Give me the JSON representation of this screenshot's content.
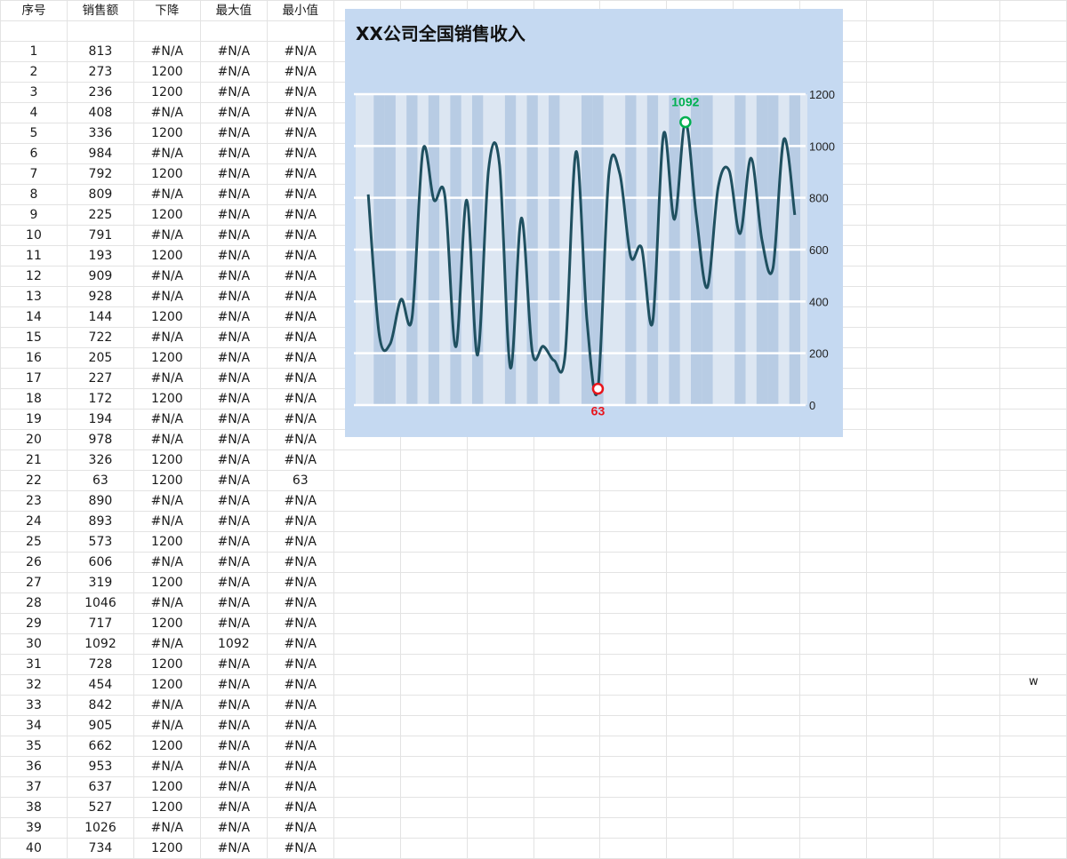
{
  "table": {
    "headers": [
      "序号",
      "销售额",
      "下降",
      "最大值",
      "最小值"
    ],
    "rows": [
      [
        "1",
        "813",
        "#N/A",
        "#N/A",
        "#N/A"
      ],
      [
        "2",
        "273",
        "1200",
        "#N/A",
        "#N/A"
      ],
      [
        "3",
        "236",
        "1200",
        "#N/A",
        "#N/A"
      ],
      [
        "4",
        "408",
        "#N/A",
        "#N/A",
        "#N/A"
      ],
      [
        "5",
        "336",
        "1200",
        "#N/A",
        "#N/A"
      ],
      [
        "6",
        "984",
        "#N/A",
        "#N/A",
        "#N/A"
      ],
      [
        "7",
        "792",
        "1200",
        "#N/A",
        "#N/A"
      ],
      [
        "8",
        "809",
        "#N/A",
        "#N/A",
        "#N/A"
      ],
      [
        "9",
        "225",
        "1200",
        "#N/A",
        "#N/A"
      ],
      [
        "10",
        "791",
        "#N/A",
        "#N/A",
        "#N/A"
      ],
      [
        "11",
        "193",
        "1200",
        "#N/A",
        "#N/A"
      ],
      [
        "12",
        "909",
        "#N/A",
        "#N/A",
        "#N/A"
      ],
      [
        "13",
        "928",
        "#N/A",
        "#N/A",
        "#N/A"
      ],
      [
        "14",
        "144",
        "1200",
        "#N/A",
        "#N/A"
      ],
      [
        "15",
        "722",
        "#N/A",
        "#N/A",
        "#N/A"
      ],
      [
        "16",
        "205",
        "1200",
        "#N/A",
        "#N/A"
      ],
      [
        "17",
        "227",
        "#N/A",
        "#N/A",
        "#N/A"
      ],
      [
        "18",
        "172",
        "1200",
        "#N/A",
        "#N/A"
      ],
      [
        "19",
        "194",
        "#N/A",
        "#N/A",
        "#N/A"
      ],
      [
        "20",
        "978",
        "#N/A",
        "#N/A",
        "#N/A"
      ],
      [
        "21",
        "326",
        "1200",
        "#N/A",
        "#N/A"
      ],
      [
        "22",
        "63",
        "1200",
        "#N/A",
        "63"
      ],
      [
        "23",
        "890",
        "#N/A",
        "#N/A",
        "#N/A"
      ],
      [
        "24",
        "893",
        "#N/A",
        "#N/A",
        "#N/A"
      ],
      [
        "25",
        "573",
        "1200",
        "#N/A",
        "#N/A"
      ],
      [
        "26",
        "606",
        "#N/A",
        "#N/A",
        "#N/A"
      ],
      [
        "27",
        "319",
        "1200",
        "#N/A",
        "#N/A"
      ],
      [
        "28",
        "1046",
        "#N/A",
        "#N/A",
        "#N/A"
      ],
      [
        "29",
        "717",
        "1200",
        "#N/A",
        "#N/A"
      ],
      [
        "30",
        "1092",
        "#N/A",
        "1092",
        "#N/A"
      ],
      [
        "31",
        "728",
        "1200",
        "#N/A",
        "#N/A"
      ],
      [
        "32",
        "454",
        "1200",
        "#N/A",
        "#N/A"
      ],
      [
        "33",
        "842",
        "#N/A",
        "#N/A",
        "#N/A"
      ],
      [
        "34",
        "905",
        "#N/A",
        "#N/A",
        "#N/A"
      ],
      [
        "35",
        "662",
        "1200",
        "#N/A",
        "#N/A"
      ],
      [
        "36",
        "953",
        "#N/A",
        "#N/A",
        "#N/A"
      ],
      [
        "37",
        "637",
        "1200",
        "#N/A",
        "#N/A"
      ],
      [
        "38",
        "527",
        "1200",
        "#N/A",
        "#N/A"
      ],
      [
        "39",
        "1026",
        "#N/A",
        "#N/A",
        "#N/A"
      ],
      [
        "40",
        "734",
        "1200",
        "#N/A",
        "#N/A"
      ]
    ]
  },
  "stray_cell": "w",
  "colors": {
    "chart_bg": "#c5d9f1",
    "plot_bg": "#dce6f2",
    "column": "#b8cce4",
    "line": "#1f5060",
    "max": "#00b050",
    "min": "#e8141b",
    "grid": "#ffffff"
  },
  "chart_data": {
    "type": "line",
    "title": "XX公司全国销售收入",
    "categories": [
      "1",
      "2",
      "3",
      "4",
      "5",
      "6",
      "7",
      "8",
      "9",
      "10",
      "11",
      "12",
      "13",
      "14",
      "15",
      "16",
      "17",
      "18",
      "19",
      "20",
      "21",
      "22",
      "23",
      "24",
      "25",
      "26",
      "27",
      "28",
      "29",
      "30",
      "31",
      "32",
      "33",
      "34",
      "35",
      "36",
      "37",
      "38",
      "39",
      "40"
    ],
    "series": [
      {
        "kind": "column",
        "values": [
          null,
          1200,
          1200,
          null,
          1200,
          null,
          1200,
          null,
          1200,
          null,
          1200,
          null,
          null,
          1200,
          null,
          1200,
          null,
          1200,
          null,
          null,
          1200,
          1200,
          null,
          null,
          1200,
          null,
          1200,
          null,
          1200,
          null,
          1200,
          1200,
          null,
          null,
          1200,
          null,
          1200,
          1200,
          null,
          1200
        ]
      },
      {
        "kind": "line",
        "smooth": true,
        "values": [
          813,
          273,
          236,
          408,
          336,
          984,
          792,
          809,
          225,
          791,
          193,
          909,
          928,
          144,
          722,
          205,
          227,
          172,
          194,
          978,
          326,
          63,
          890,
          893,
          573,
          606,
          319,
          1046,
          717,
          1092,
          728,
          454,
          842,
          905,
          662,
          953,
          637,
          527,
          1026,
          734
        ]
      },
      {
        "kind": "marker",
        "values": [
          null,
          null,
          null,
          null,
          null,
          null,
          null,
          null,
          null,
          null,
          null,
          null,
          null,
          null,
          null,
          null,
          null,
          null,
          null,
          null,
          null,
          null,
          null,
          null,
          null,
          null,
          null,
          null,
          null,
          1092,
          null,
          null,
          null,
          null,
          null,
          null,
          null,
          null,
          null,
          null
        ]
      },
      {
        "kind": "marker",
        "values": [
          null,
          null,
          null,
          null,
          null,
          null,
          null,
          null,
          null,
          null,
          null,
          null,
          null,
          null,
          null,
          null,
          null,
          null,
          null,
          null,
          null,
          63,
          null,
          null,
          null,
          null,
          null,
          null,
          null,
          null,
          null,
          null,
          null,
          null,
          null,
          null,
          null,
          null,
          null,
          null
        ]
      }
    ],
    "yaxis": {
      "min": 0,
      "max": 1200,
      "ticks": [
        0,
        200,
        400,
        600,
        800,
        1000,
        1200
      ],
      "position": "right"
    },
    "annotations": [
      {
        "label": "1092",
        "index": 30
      },
      {
        "label": "63",
        "index": 22
      }
    ],
    "legend": "none",
    "grid": true
  }
}
